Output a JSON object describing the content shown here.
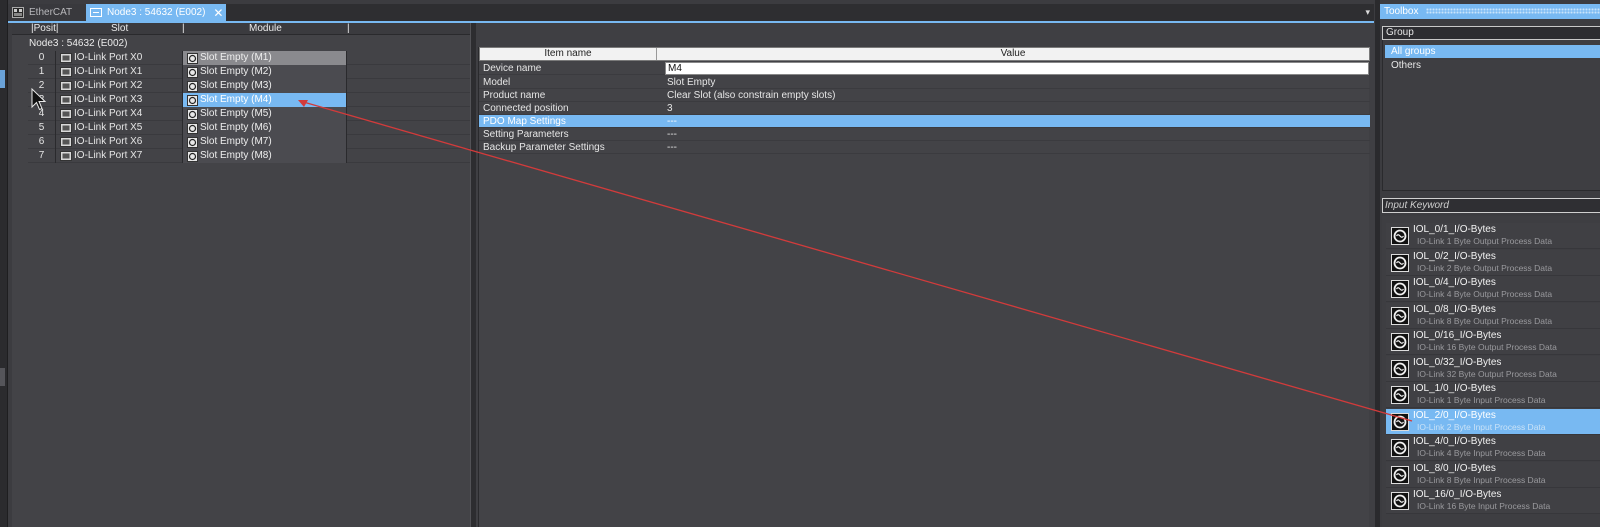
{
  "tabs": [
    {
      "label": "EtherCAT",
      "active": false
    },
    {
      "label": "Node3 : 54632 (E002)",
      "active": true,
      "close": "✕"
    }
  ],
  "tab_menu_icon": "▾",
  "slot_table": {
    "columns": {
      "position": "Posit",
      "slot": "Slot",
      "module": "Module"
    },
    "node_title": "Node3 : 54632 (E002)",
    "rows": [
      {
        "pos": "0",
        "slot": "IO-Link Port X0",
        "module": "Slot Empty (M1)"
      },
      {
        "pos": "1",
        "slot": "IO-Link Port X1",
        "module": "Slot Empty (M2)"
      },
      {
        "pos": "2",
        "slot": "IO-Link Port X2",
        "module": "Slot Empty (M3)"
      },
      {
        "pos": "3",
        "slot": "IO-Link Port X3",
        "module": "Slot Empty (M4)"
      },
      {
        "pos": "4",
        "slot": "IO-Link Port X4",
        "module": "Slot Empty (M5)"
      },
      {
        "pos": "5",
        "slot": "IO-Link Port X5",
        "module": "Slot Empty (M6)"
      },
      {
        "pos": "6",
        "slot": "IO-Link Port X6",
        "module": "Slot Empty (M7)"
      },
      {
        "pos": "7",
        "slot": "IO-Link Port X7",
        "module": "Slot Empty (M8)"
      }
    ],
    "selected_row": 3
  },
  "properties": {
    "columns": {
      "name": "Item name",
      "value": "Value"
    },
    "device_name_label": "Device name",
    "device_name_value": "M4",
    "rows": [
      {
        "name": "Model",
        "value": "Slot Empty"
      },
      {
        "name": "Product name",
        "value": "Clear Slot (also constrain empty slots)"
      },
      {
        "name": "Connected position",
        "value": "3"
      },
      {
        "name": "PDO Map Settings",
        "value": "---"
      },
      {
        "name": "Setting Parameters",
        "value": "---"
      },
      {
        "name": "Backup Parameter Settings",
        "value": "---"
      }
    ]
  },
  "toolbox": {
    "title": "Toolbox",
    "group_header": "Group",
    "groups": [
      "All groups",
      "Others"
    ],
    "keyword_placeholder": "Input Keyword",
    "modules": [
      {
        "name": "IOL_0/1_I/O-Bytes",
        "desc": "IO-Link 1 Byte Output Process Data"
      },
      {
        "name": "IOL_0/2_I/O-Bytes",
        "desc": "IO-Link 2 Byte Output Process Data"
      },
      {
        "name": "IOL_0/4_I/O-Bytes",
        "desc": "IO-Link 4 Byte Output Process Data"
      },
      {
        "name": "IOL_0/8_I/O-Bytes",
        "desc": "IO-Link 8 Byte Output Process Data"
      },
      {
        "name": "IOL_0/16_I/O-Bytes",
        "desc": "IO-Link 16 Byte Output Process Data"
      },
      {
        "name": "IOL_0/32_I/O-Bytes",
        "desc": "IO-Link 32 Byte Output Process Data"
      },
      {
        "name": "IOL_1/0_I/O-Bytes",
        "desc": "IO-Link 1 Byte Input Process Data"
      },
      {
        "name": "IOL_2/0_I/O-Bytes",
        "desc": "IO-Link 2 Byte Input Process Data"
      },
      {
        "name": "IOL_4/0_I/O-Bytes",
        "desc": "IO-Link 4 Byte Input Process Data"
      },
      {
        "name": "IOL_8/0_I/O-Bytes",
        "desc": "IO-Link 8 Byte Input Process Data"
      },
      {
        "name": "IOL_16/0_I/O-Bytes",
        "desc": "IO-Link 16 Byte Input Process Data"
      }
    ],
    "selected_module": 7
  },
  "colors": {
    "accent": "#78b9f2",
    "background": "#3c3c40",
    "drag_line": "#d23b3b"
  },
  "icons": {
    "port": "io-link-port-icon",
    "module": "module-slot-icon",
    "toolbox_item": "io-link-module-icon",
    "cursor": "mouse-pointer-icon"
  }
}
